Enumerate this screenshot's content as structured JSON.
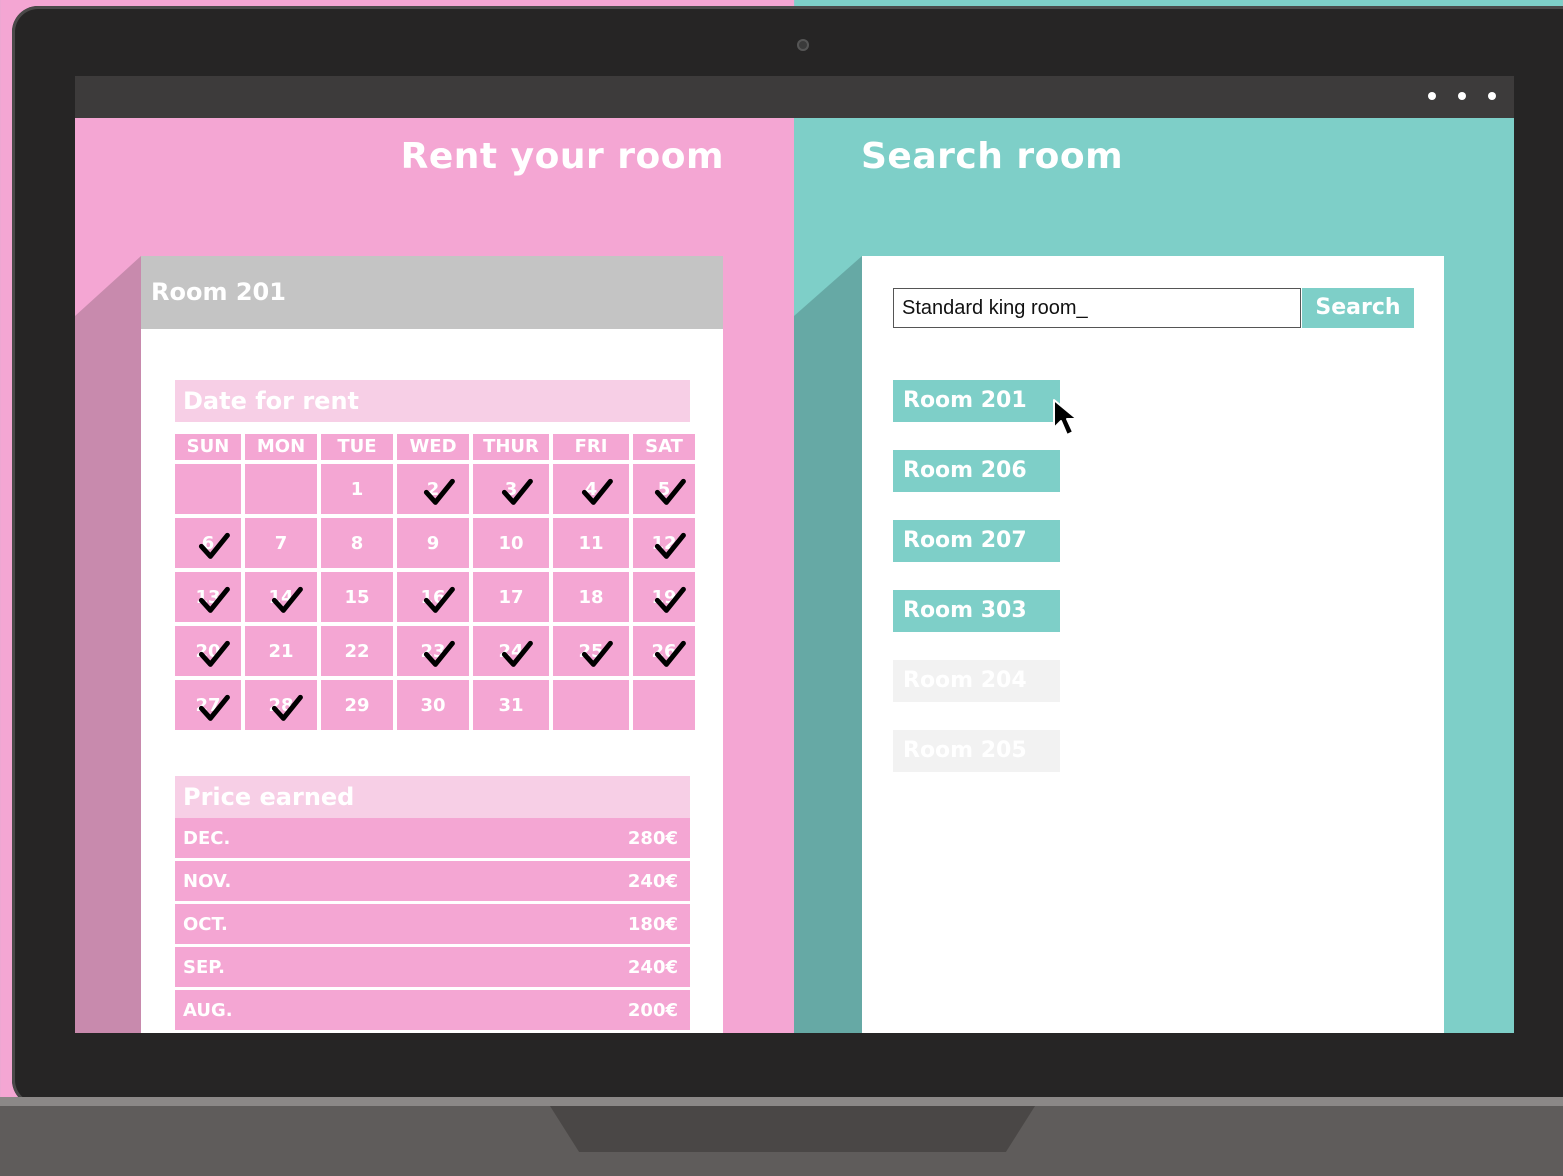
{
  "left": {
    "title": "Rent your room",
    "card_title": "Room 201",
    "date_section_title": "Date for rent",
    "calendar": {
      "days": [
        "SUN",
        "MON",
        "TUE",
        "WED",
        "THUR",
        "FRI",
        "SAT"
      ],
      "cells": [
        {
          "day": "",
          "checked": false
        },
        {
          "day": "",
          "checked": false
        },
        {
          "day": "1",
          "checked": false
        },
        {
          "day": "2",
          "checked": true
        },
        {
          "day": "3",
          "checked": true
        },
        {
          "day": "4",
          "checked": true
        },
        {
          "day": "5",
          "checked": true
        },
        {
          "day": "6",
          "checked": true
        },
        {
          "day": "7",
          "checked": false
        },
        {
          "day": "8",
          "checked": false
        },
        {
          "day": "9",
          "checked": false
        },
        {
          "day": "10",
          "checked": false
        },
        {
          "day": "11",
          "checked": false
        },
        {
          "day": "12",
          "checked": true
        },
        {
          "day": "13",
          "checked": true
        },
        {
          "day": "14",
          "checked": true
        },
        {
          "day": "15",
          "checked": false
        },
        {
          "day": "16",
          "checked": true
        },
        {
          "day": "17",
          "checked": false
        },
        {
          "day": "18",
          "checked": false
        },
        {
          "day": "19",
          "checked": true
        },
        {
          "day": "20",
          "checked": true
        },
        {
          "day": "21",
          "checked": false
        },
        {
          "day": "22",
          "checked": false
        },
        {
          "day": "23",
          "checked": true
        },
        {
          "day": "24",
          "checked": true
        },
        {
          "day": "25",
          "checked": true
        },
        {
          "day": "26",
          "checked": true
        },
        {
          "day": "27",
          "checked": true
        },
        {
          "day": "28",
          "checked": true
        },
        {
          "day": "29",
          "checked": false
        },
        {
          "day": "30",
          "checked": false
        },
        {
          "day": "31",
          "checked": false
        },
        {
          "day": "",
          "checked": false
        },
        {
          "day": "",
          "checked": false
        }
      ]
    },
    "price_section_title": "Price earned",
    "prices": [
      {
        "month": "DEC.",
        "amount": "280€"
      },
      {
        "month": "NOV.",
        "amount": "240€"
      },
      {
        "month": "OCT.",
        "amount": "180€"
      },
      {
        "month": "SEP.",
        "amount": "240€"
      },
      {
        "month": "AUG.",
        "amount": "200€"
      }
    ]
  },
  "right": {
    "title": "Search room",
    "search": {
      "value": "Standard king room_",
      "button_label": "Search"
    },
    "rooms": [
      {
        "label": "Room 201",
        "active": true
      },
      {
        "label": "Room 206",
        "active": true
      },
      {
        "label": "Room 207",
        "active": true
      },
      {
        "label": "Room 303",
        "active": true
      },
      {
        "label": "Room 204",
        "active": false
      },
      {
        "label": "Room 205",
        "active": false
      }
    ]
  },
  "colors": {
    "pink": "#f4a6d3",
    "pink_light": "#f7cfe6",
    "teal": "#7ecfc8",
    "header_gray": "#c4c4c4",
    "bezel": "#262525"
  }
}
